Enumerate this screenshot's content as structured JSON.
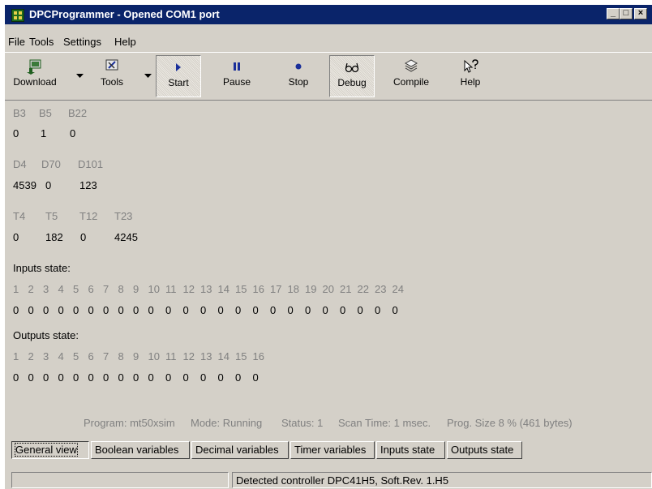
{
  "window": {
    "title": "DPCProgrammer - Opened COM1 port",
    "controls": {
      "minimize": "_",
      "maximize": "□",
      "close": "×"
    }
  },
  "menu": {
    "items": [
      "File",
      "Tools",
      "Settings",
      "Help"
    ]
  },
  "toolbar": {
    "buttons": [
      {
        "label": "Download",
        "icon": "download-icon"
      },
      {
        "label": "Tools",
        "icon": "tools-icon"
      },
      {
        "label": "Start",
        "icon": "play-icon",
        "pressed": true
      },
      {
        "label": "Pause",
        "icon": "pause-icon"
      },
      {
        "label": "Stop",
        "icon": "stop-icon"
      },
      {
        "label": "Debug",
        "icon": "glasses-icon",
        "pressed": true
      },
      {
        "label": "Compile",
        "icon": "compile-icon"
      },
      {
        "label": "Help",
        "icon": "help-arrow-icon"
      }
    ]
  },
  "boolean_vars": {
    "labels": [
      "B3",
      "B5",
      "B22"
    ],
    "values": [
      "0",
      "1",
      "0"
    ]
  },
  "decimal_vars": {
    "labels": [
      "D4",
      "D70",
      "D101"
    ],
    "values": [
      "4539",
      "0",
      "123"
    ]
  },
  "timer_vars": {
    "labels": [
      "T4",
      "T5",
      "T12",
      "T23"
    ],
    "values": [
      "0",
      "182",
      "0",
      "4245"
    ]
  },
  "inputs_state": {
    "title": "Inputs state:",
    "channels": [
      "1",
      "2",
      "3",
      "4",
      "5",
      "6",
      "7",
      "8",
      "9",
      "10",
      "11",
      "12",
      "13",
      "14",
      "15",
      "16",
      "17",
      "18",
      "19",
      "20",
      "21",
      "22",
      "23",
      "24"
    ],
    "values": [
      "0",
      "0",
      "0",
      "0",
      "0",
      "0",
      "0",
      "0",
      "0",
      "0",
      "0",
      "0",
      "0",
      "0",
      "0",
      "0",
      "0",
      "0",
      "0",
      "0",
      "0",
      "0",
      "0",
      "0"
    ]
  },
  "outputs_state": {
    "title": "Outputs state:",
    "channels": [
      "1",
      "2",
      "3",
      "4",
      "5",
      "6",
      "7",
      "8",
      "9",
      "10",
      "11",
      "12",
      "13",
      "14",
      "15",
      "16"
    ],
    "values": [
      "0",
      "0",
      "0",
      "0",
      "0",
      "0",
      "0",
      "0",
      "0",
      "0",
      "0",
      "0",
      "0",
      "0",
      "0",
      "0"
    ]
  },
  "status_line": {
    "program": "Program: mt50xsim",
    "mode": "Mode: Running",
    "status": "Status: 1",
    "scan_time": "Scan Time: 1 msec.",
    "prog_size": "Prog. Size 8 %  (461 bytes)"
  },
  "tabs": [
    "General view",
    "Boolean variables",
    "Decimal variables",
    "Timer variables",
    "Inputs state",
    "Outputs state"
  ],
  "active_tab": "General view",
  "statusbar": {
    "message": "Detected controller DPC41H5, Soft.Rev. 1.H5"
  },
  "colors": {
    "titlebar": "#0a246a",
    "face": "#d4d0c8",
    "label_grey": "#808080",
    "icon_blue": "#1a2f9a"
  }
}
